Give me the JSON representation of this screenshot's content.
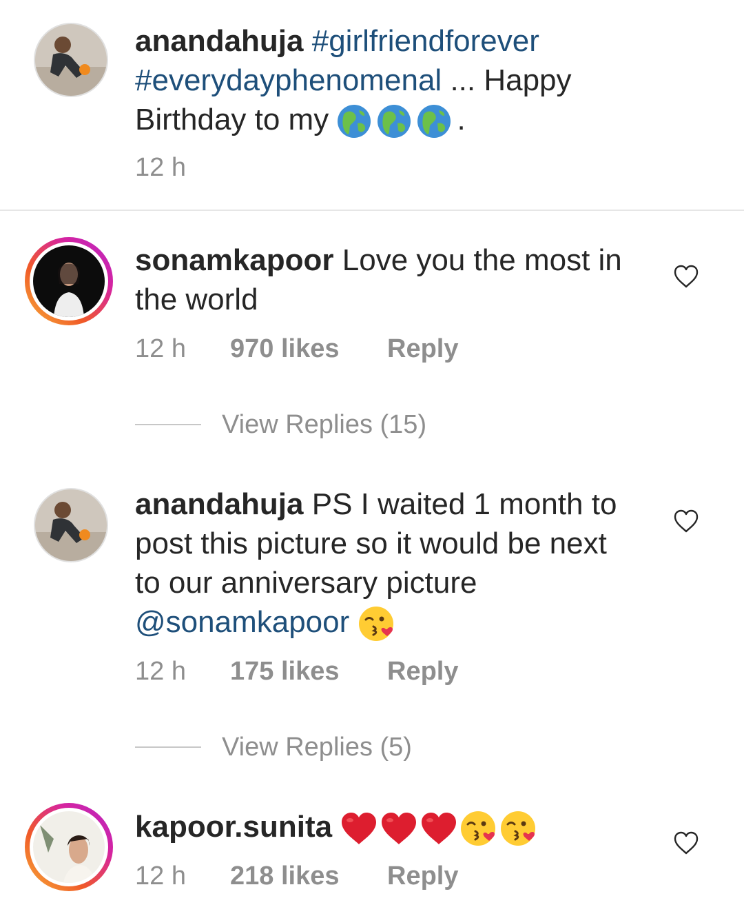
{
  "caption": {
    "username": "anandahuja",
    "hashtag1": "#girlfriendforever",
    "hashtag2": "#everydayphenomenal",
    "text_before": "... Happy Birthday to my",
    "text_after": ".",
    "emojis": [
      "globe-africa-icon",
      "globe-americas-icon",
      "globe-asia-icon"
    ],
    "time": "12 h"
  },
  "comments": [
    {
      "username": "sonamkapoor",
      "text": "Love you the most in the world",
      "time": "12 h",
      "likes": "970 likes",
      "reply_label": "Reply",
      "view_replies": "View Replies (15)"
    },
    {
      "username": "anandahuja",
      "text": "PS I waited 1 month to post this picture so it would be next to our anniversary picture",
      "mention": "@sonamkapoor",
      "time": "12 h",
      "likes": "175 likes",
      "reply_label": "Reply",
      "view_replies": "View Replies (5)"
    },
    {
      "username": "kapoor.sunita",
      "text": "",
      "emojis": [
        "red-heart-icon",
        "red-heart-icon",
        "red-heart-icon",
        "kissing-face-icon",
        "kissing-face-icon"
      ],
      "time": "12 h",
      "likes": "218 likes",
      "reply_label": "Reply"
    }
  ],
  "colors": {
    "text": "#262626",
    "meta": "#8e8e8e",
    "hashtag": "#1e4f7a",
    "story_ring_start": "#f7b13a",
    "story_ring_end": "#b526c7"
  }
}
